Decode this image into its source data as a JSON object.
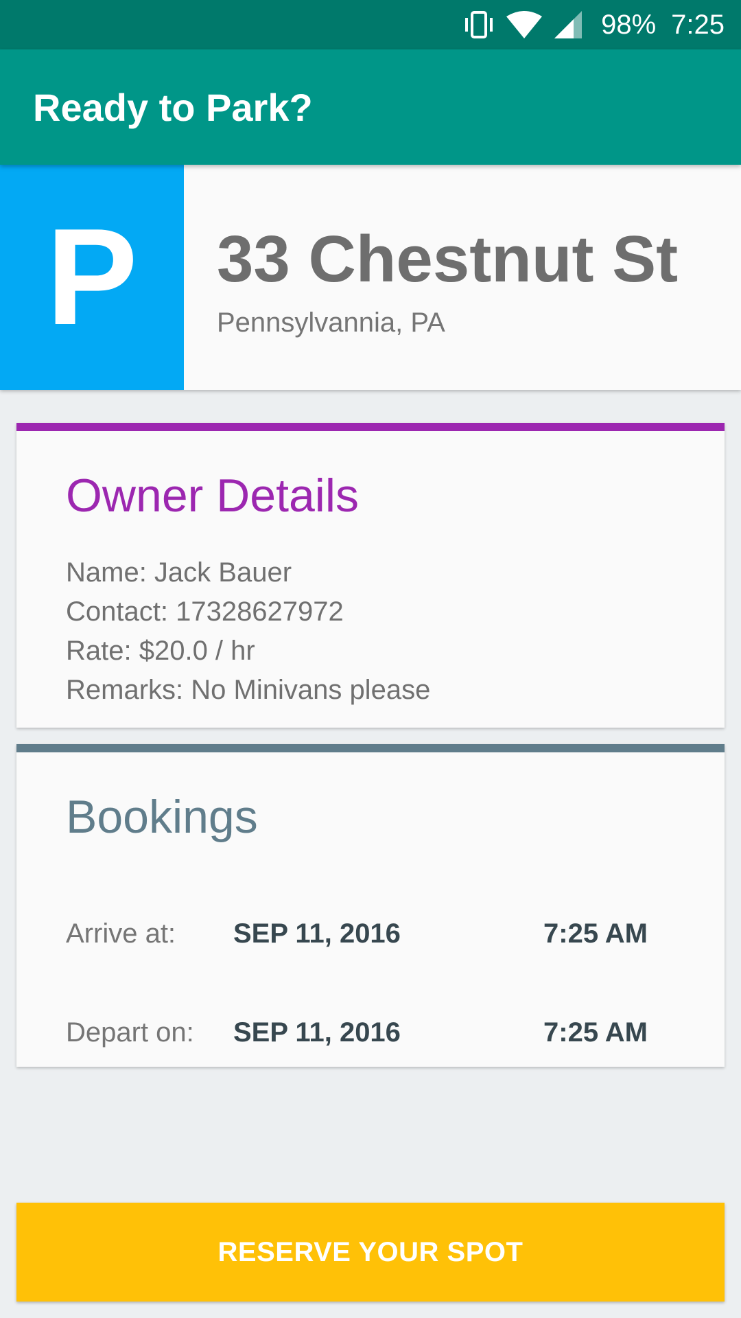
{
  "status_bar": {
    "battery": "98%",
    "time": "7:25",
    "icons": [
      "vibrate-icon",
      "wifi-icon",
      "signal-icon"
    ]
  },
  "app_bar": {
    "title": "Ready to Park?"
  },
  "spot": {
    "badge_letter": "P",
    "street": "33 Chestnut St",
    "city": "Pennsylvannia, PA"
  },
  "owner": {
    "heading": "Owner Details",
    "name_line": "Name: Jack Bauer",
    "contact_line": "Contact: 17328627972",
    "rate_line": "Rate: $20.0 / hr",
    "remarks_line": "Remarks: No Minivans please"
  },
  "bookings": {
    "heading": "Bookings",
    "arrive": {
      "label": "Arrive at:",
      "date": "SEP 11, 2016",
      "time": "7:25 AM"
    },
    "depart": {
      "label": "Depart on:",
      "date": "SEP 11, 2016",
      "time": "7:25 AM"
    }
  },
  "reserve_button": {
    "label": "RESERVE YOUR SPOT"
  },
  "colors": {
    "status_bar": "#00796b",
    "app_bar": "#009688",
    "parking_badge": "#03a9f4",
    "owner_accent": "#9c27b0",
    "bookings_accent": "#607d8b",
    "reserve_button": "#ffc107",
    "background": "#eceff1"
  }
}
